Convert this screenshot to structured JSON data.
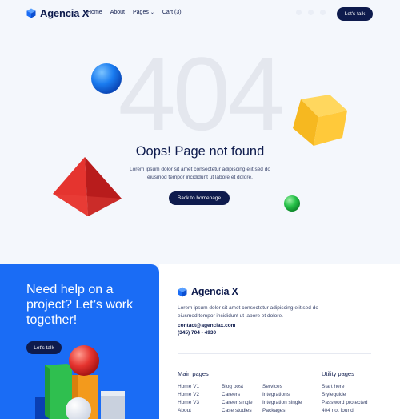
{
  "header": {
    "brand": "Agencia X",
    "nav": [
      {
        "label": "Home"
      },
      {
        "label": "About"
      },
      {
        "label": "Pages",
        "chevron": "⌄"
      },
      {
        "label": "Cart (3)"
      }
    ],
    "cta_label": "Let's talk"
  },
  "hero": {
    "big_code": "404",
    "title": "Oops! Page not found",
    "description": "Lorem ipsum dolor sit amet consectetur adipiscing elit sed do eiusmod tempor incididunt ut labore et dolore.",
    "button_label": "Back to homepage"
  },
  "footer": {
    "cta_title": "Need help on a project? Let’s work together!",
    "cta_button": "Let's talk",
    "brand": "Agencia X",
    "description": "Lorem ipsum dolor sit amet consectetur adipiscing elit sed do eiusmod tempor incididunt ut labore et dolore.",
    "email": "contact@agenciax.com",
    "phone": "(345) 704 - 4930",
    "main_pages_title": "Main pages",
    "main_col1": [
      "Home V1",
      "Home V2",
      "Home V3",
      "About"
    ],
    "main_col2": [
      "Blog post",
      "Careers",
      "Career single",
      "Case studies"
    ],
    "main_col3": [
      "Services",
      "Integrations",
      "Integration single",
      "Packages"
    ],
    "utility_pages_title": "Utility pages",
    "utility_col": [
      "Start here",
      "Styleguide",
      "Password protected",
      "404 not found"
    ]
  },
  "colors": {
    "navy": "#0e1b4d",
    "blue": "#1a6cf5",
    "page_bg": "#f4f7fc",
    "big_text": "#e4e7ee"
  }
}
